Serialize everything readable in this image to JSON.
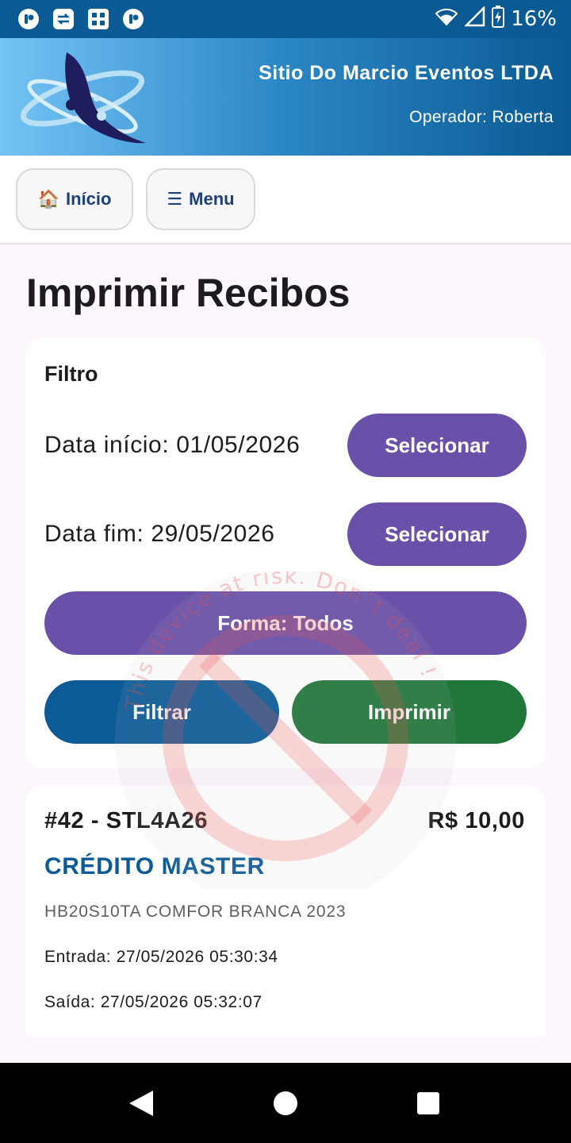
{
  "status_bar": {
    "battery": "16%",
    "icons": [
      "app-icon-p",
      "app-icon-transfer",
      "app-icon-grid",
      "app-icon-p2",
      "wifi-icon",
      "signal-icon",
      "battery-charging-icon"
    ]
  },
  "header": {
    "company": "Sitio Do Marcio Eventos LTDA",
    "operator": "Operador: Roberta",
    "logo_icon": "orbit-logo"
  },
  "nav": {
    "home_icon": "🏠",
    "home_label": "Início",
    "menu_icon": "☰",
    "menu_label": "Menu"
  },
  "page": {
    "title": "Imprimir Recibos"
  },
  "filter": {
    "label": "Filtro",
    "date_start": "Data início: 01/05/2026",
    "date_end": "Data fim: 29/05/2026",
    "select_label": "Selecionar",
    "payment_form": "Forma: Todos",
    "filter_button": "Filtrar",
    "print_button": "Imprimir"
  },
  "receipts": [
    {
      "id_plate": "#42 - STL4A26",
      "value": "R$ 10,00",
      "payment": "CRÉDITO MASTER",
      "vehicle": "HB20S10TA COMFOR BRANCA 2023",
      "entry": "Entrada: 27/05/2026 05:30:34",
      "exit": "Saída: 27/05/2026 05:32:07"
    }
  ],
  "watermark": {
    "text": "This device at risk. Don`t deal !"
  },
  "colors": {
    "primary_purple": "#6950a8",
    "primary_blue": "#0c5b97",
    "print_green": "#21773a",
    "status_bar": "#0b5a93",
    "background": "#fdf7fd"
  }
}
